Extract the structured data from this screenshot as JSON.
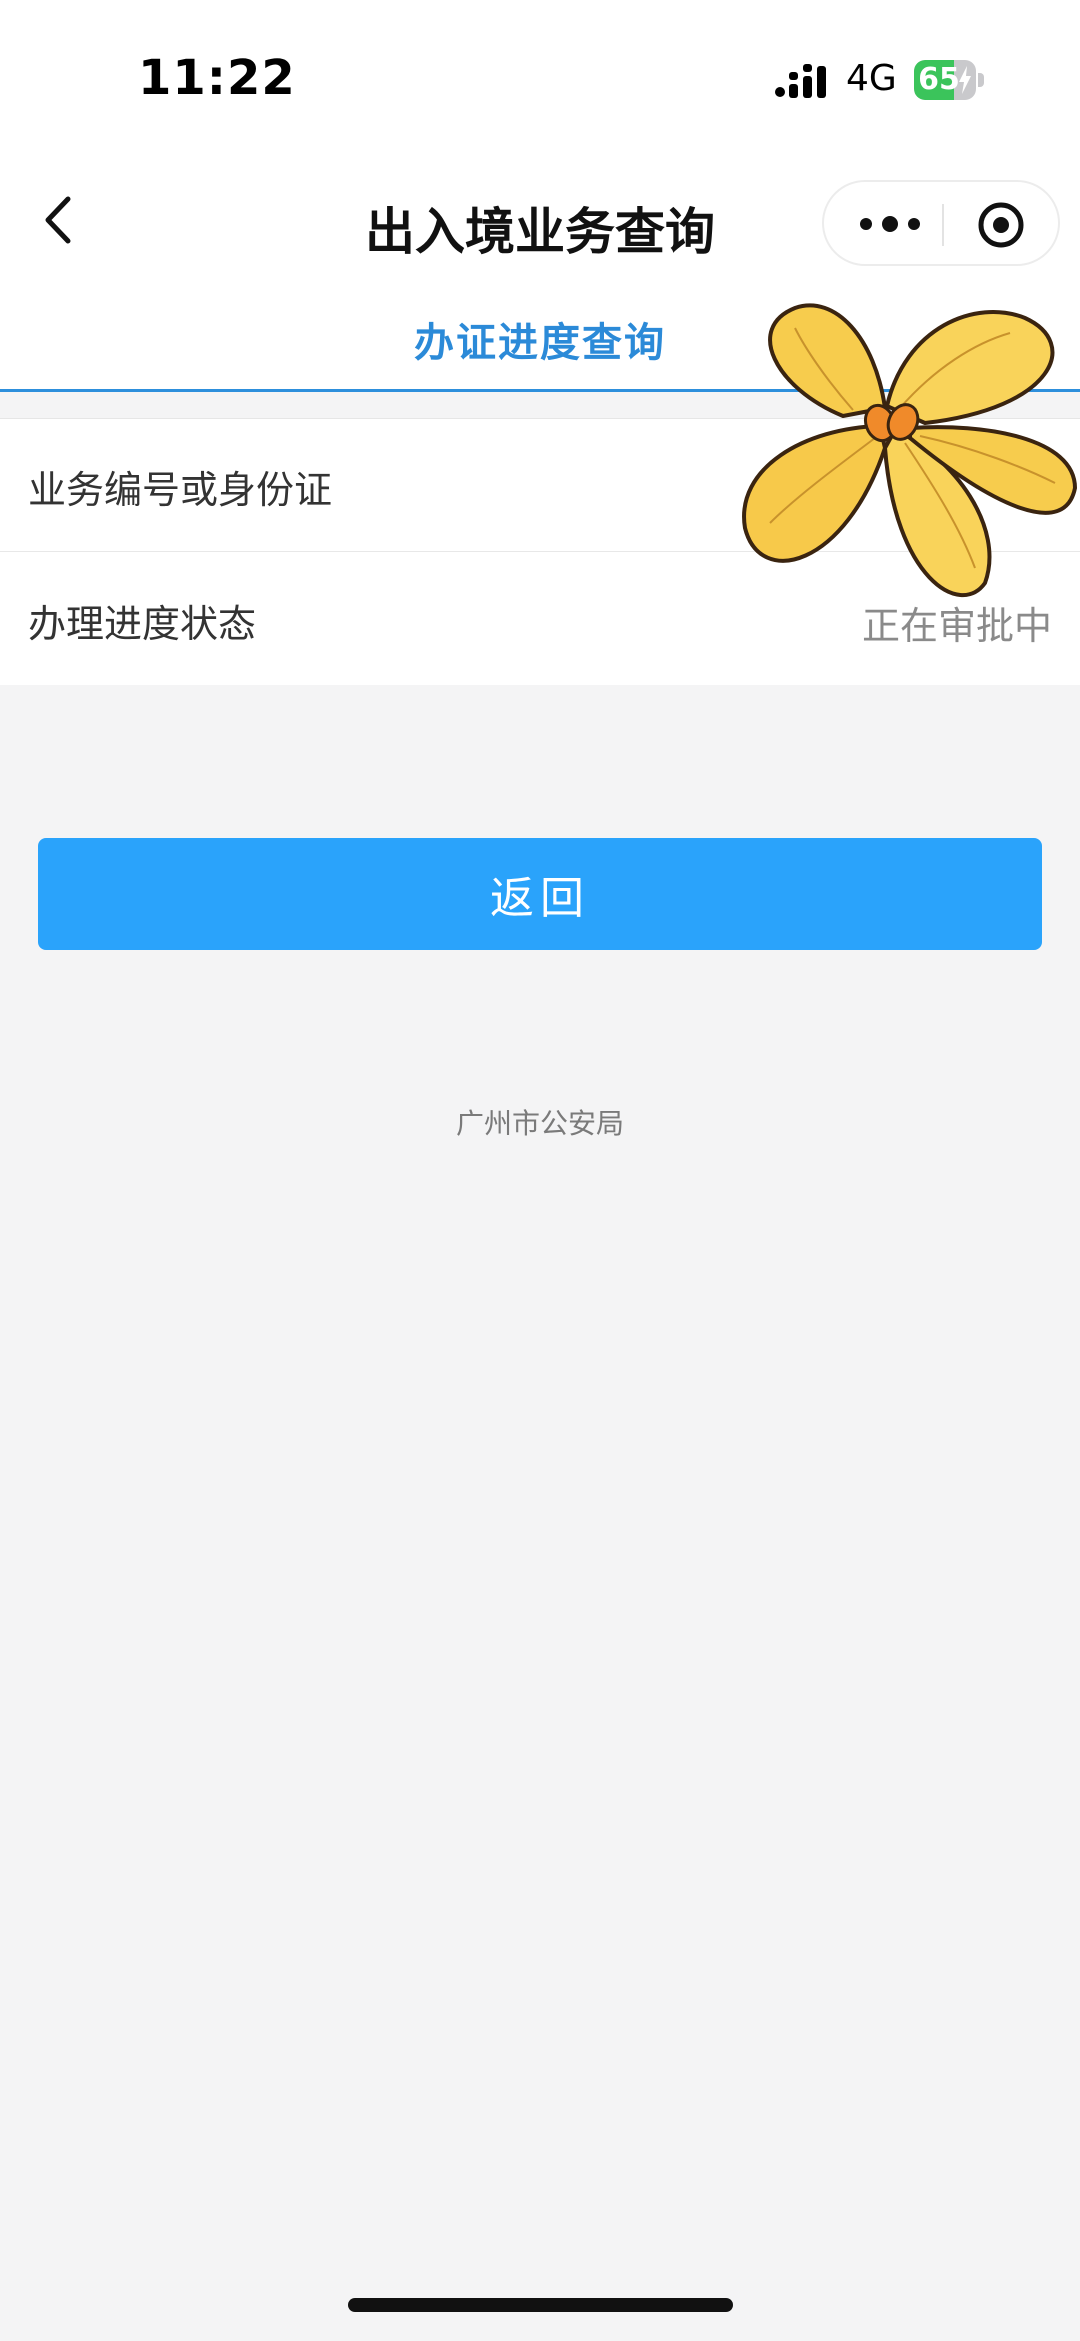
{
  "status_bar": {
    "time": "11:22",
    "network": "4G",
    "battery_level": "65",
    "battery_fraction": 0.65
  },
  "nav": {
    "title": "出入境业务查询",
    "back_icon": "chevron-left-icon",
    "more_icon": "more-dots-icon",
    "close_icon": "target-close-icon"
  },
  "tabs": [
    {
      "label": "办证进度查询",
      "active": true
    }
  ],
  "form": {
    "rows": [
      {
        "label": "业务编号或身份证",
        "value": ""
      },
      {
        "label": "办理进度状态",
        "value": "正在审批中"
      }
    ]
  },
  "actions": {
    "return_label": "返回"
  },
  "footer": {
    "text": "广州市公安局"
  },
  "colors": {
    "accent": "#2aa3fb",
    "tab_active": "#2b8ad8",
    "background": "#f4f4f5",
    "battery_green": "#3bc45b"
  }
}
